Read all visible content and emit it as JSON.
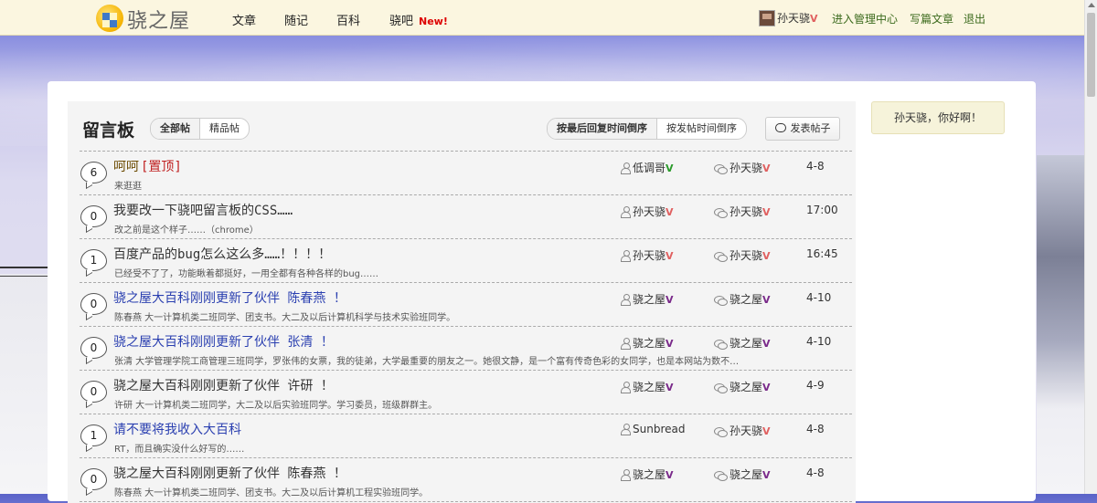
{
  "site": {
    "logo_text": "骁之屋"
  },
  "nav": [
    {
      "label": "文章"
    },
    {
      "label": "随记"
    },
    {
      "label": "百科"
    },
    {
      "label": "骁吧",
      "badge": "New!"
    }
  ],
  "user": {
    "name": "孙天骁",
    "v": "V",
    "links": [
      "进入管理中心",
      "写篇文章",
      "退出"
    ]
  },
  "board": {
    "title": "留言板",
    "filter_tabs": [
      "全部帖",
      "精品帖"
    ],
    "sort_tabs": [
      "按最后回复时间倒序",
      "按发帖时间倒序"
    ],
    "post_button": "发表帖子"
  },
  "greeting": "孙天骁，你好啊！",
  "posts": [
    {
      "count": "6",
      "title": "呵呵",
      "pinned": "[置顶]",
      "summary": "来逛逛",
      "author": "低调哥",
      "author_v": "V",
      "replier": "孙天骁",
      "replier_v": "V",
      "time": "4-8"
    },
    {
      "count": "0",
      "title": "我要改一下骁吧留言板的CSS……",
      "summary": "改之前是这个样子……（chrome）",
      "author": "孙天骁",
      "author_v": "V",
      "replier": "孙天骁",
      "replier_v": "V",
      "time": "17:00"
    },
    {
      "count": "1",
      "title": "百度产品的bug怎么这么多……！！！！",
      "summary": "已经受不了了，功能瞅着都挺好，一用全都有各种各样的bug……",
      "author": "孙天骁",
      "author_v": "V",
      "replier": "孙天骁",
      "replier_v": "V",
      "time": "16:45"
    },
    {
      "count": "0",
      "title": "骁之屋大百科刚刚更新了伙伴 陈春燕 ！",
      "summary": "陈春燕 大一计算机类二班同学、团支书。大二及以后计算机科学与技术实验班同学。",
      "author": "骁之屋",
      "author_v": "V",
      "replier": "骁之屋",
      "replier_v": "V",
      "time": "4-10"
    },
    {
      "count": "0",
      "title": "骁之屋大百科刚刚更新了伙伴 张清 ！",
      "summary": "张清 大学管理学院工商管理三班同学，罗张伟的女票，我的徒弟，大学最重要的朋友之一。她很文静，是一个富有传奇色彩的女同学，也是本网站为数不…",
      "author": "骁之屋",
      "author_v": "V",
      "replier": "骁之屋",
      "replier_v": "V",
      "time": "4-10"
    },
    {
      "count": "0",
      "title": "骁之屋大百科刚刚更新了伙伴 许研 ！",
      "summary": "许研 大一计算机类二班同学，大二及以后实验班同学。学习委员，班级群群主。",
      "author": "骁之屋",
      "author_v": "V",
      "replier": "骁之屋",
      "replier_v": "V",
      "time": "4-9"
    },
    {
      "count": "1",
      "title": "请不要将我收入大百科",
      "summary": "RT，而且确实没什么好写的……",
      "author": "Sunbread",
      "author_v": "",
      "replier": "孙天骁",
      "replier_v": "V",
      "time": "4-8"
    },
    {
      "count": "0",
      "title": "骁之屋大百科刚刚更新了伙伴 陈春燕 ！",
      "summary": "陈春燕 大一计算机类二班同学、团支书。大二及以后计算机工程实验班同学。",
      "author": "骁之屋",
      "author_v": "V",
      "replier": "骁之屋",
      "replier_v": "V",
      "time": "4-8"
    }
  ]
}
